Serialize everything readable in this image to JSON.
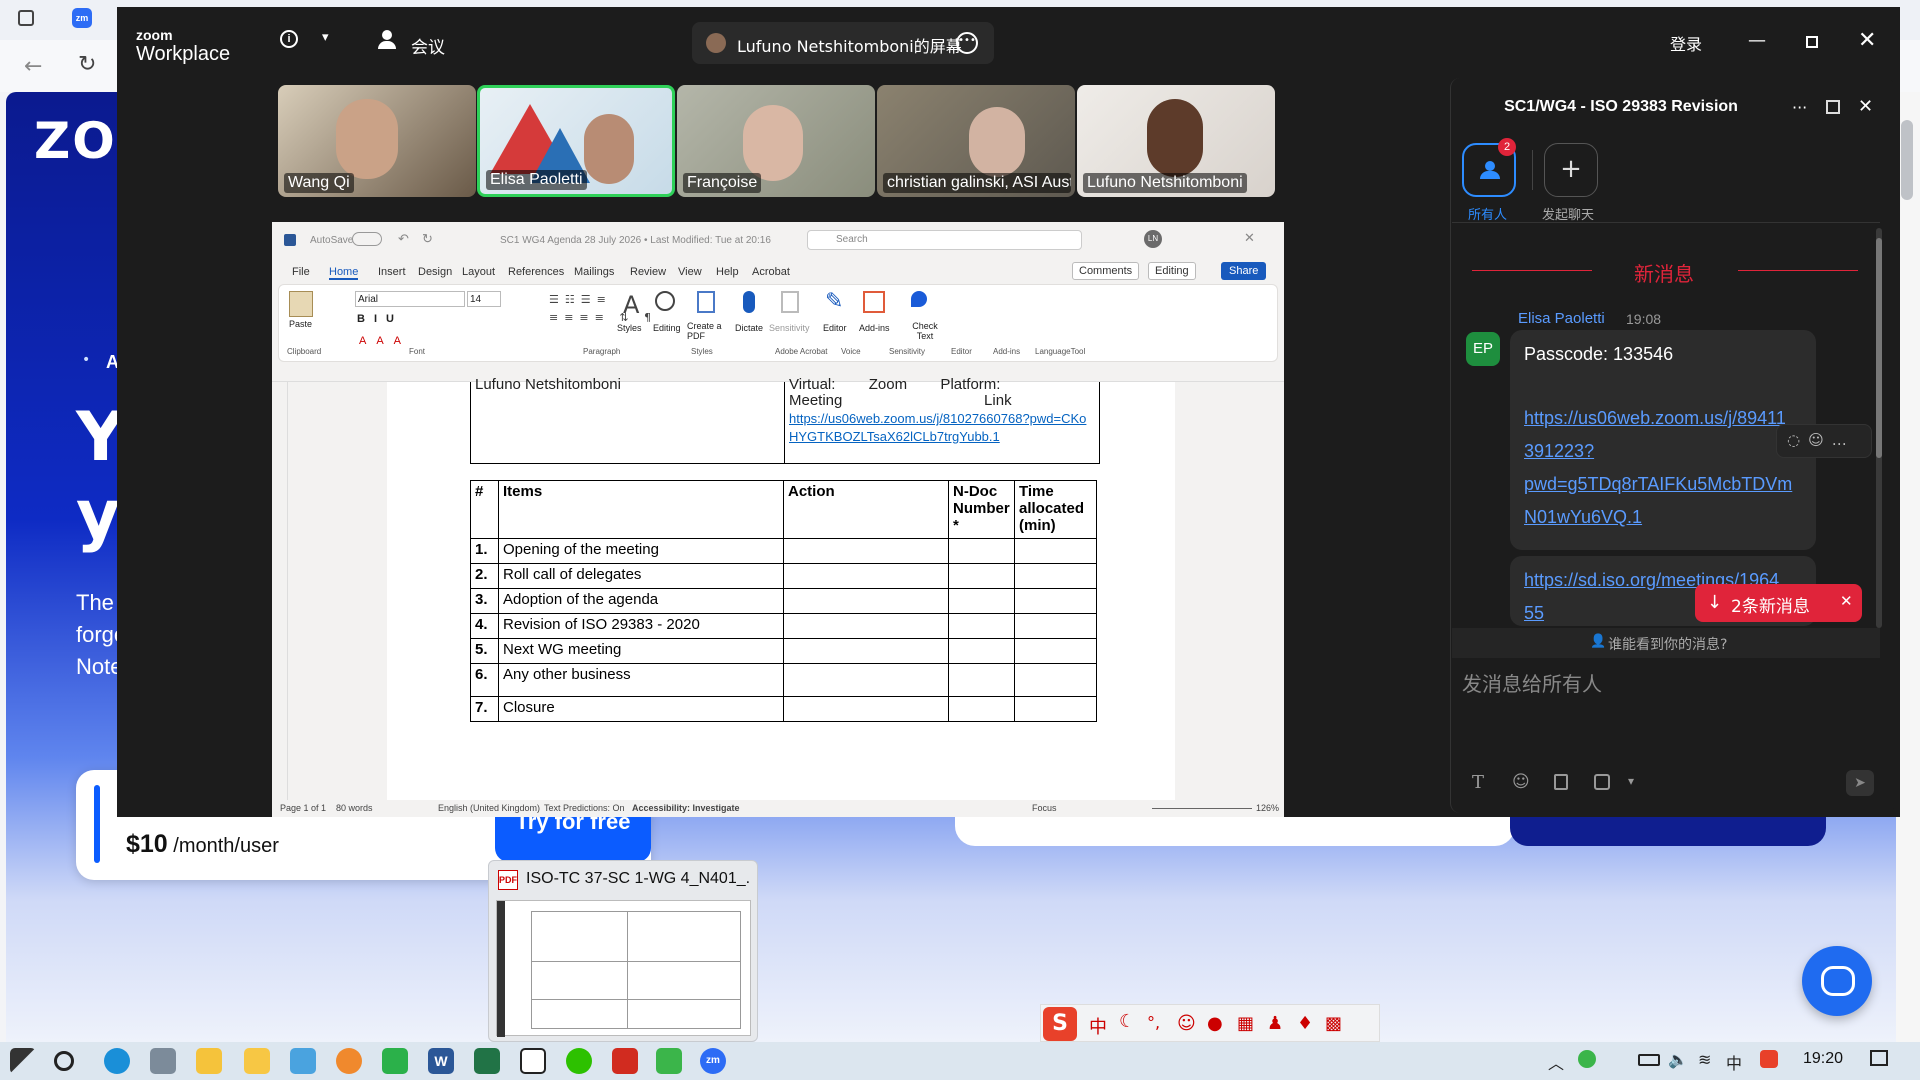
{
  "browser": {
    "site_logo": "ZOO",
    "hero_lines": [
      "Y",
      "y"
    ],
    "hero_bullet": "A",
    "para_lines": [
      "The l",
      "forge",
      "Note"
    ],
    "price_value": "$10",
    "price_unit": "/month/user",
    "try_button": "Try for free"
  },
  "zoom": {
    "brand_small": "zoom",
    "brand_large": "Workplace",
    "meeting_label": "会议",
    "share_label": "Lufuno Netshitomboni的屏幕",
    "login_label": "登录",
    "participants": [
      {
        "name": "Wang Qi",
        "color": "#6a5a48"
      },
      {
        "name": "Elisa Paoletti",
        "color": "#c7dbe8",
        "active": true
      },
      {
        "name": "Françoise",
        "color": "#8a8d7c"
      },
      {
        "name": "christian galinski, ASI Aust...",
        "color": "#5e5950"
      },
      {
        "name": "Lufuno Netshitomboni",
        "color": "#d8d2cc"
      }
    ]
  },
  "word": {
    "titlebar": "SC1 WG4 Agenda 28 July 2026 • Last Modified: Tue at 20:16",
    "autosave": "AutoSave",
    "search_placeholder": "Search",
    "user_initials": "LN",
    "menu": [
      "File",
      "Home",
      "Insert",
      "Design",
      "Layout",
      "References",
      "Mailings",
      "Review",
      "View",
      "Help",
      "Acrobat"
    ],
    "comments_label": "Comments",
    "editing_label": "Editing",
    "share_label": "Share",
    "font_name": "Arial",
    "font_size": "14",
    "ribbon_groups": [
      "Clipboard",
      "Font",
      "Paragraph",
      "Styles",
      "Adobe Acrobat",
      "Voice",
      "Sensitivity",
      "Editor",
      "Add-ins",
      "LanguageTool"
    ],
    "ribbon_buttons": [
      "Paste",
      "Styles",
      "Editing",
      "Create a PDF",
      "Dictate",
      "Sensitivity",
      "Editor",
      "Add-ins",
      "Check Text"
    ],
    "top_box": {
      "left_text": "Lufuno Netshitomboni",
      "right_line1": "Virtual:        Zoom        Platform:",
      "right_line2": "Meeting                                  Link",
      "link": "https://us06web.zoom.us/j/81027660768?pwd=CKoHYGTKBOZLTsaX62lCLb7trgYubb.1"
    },
    "table_headers": [
      "#",
      "Items",
      "Action",
      "N-Doc Number *",
      "Time allocated (min)"
    ],
    "agenda_rows": [
      {
        "num": "1.",
        "item": "Opening of the meeting"
      },
      {
        "num": "2.",
        "item": "Roll call of delegates"
      },
      {
        "num": "3.",
        "item": "Adoption of the agenda"
      },
      {
        "num": "4.",
        "item": "Revision of ISO 29383 - 2020"
      },
      {
        "num": "5.",
        "item": "Next WG meeting"
      },
      {
        "num": "6.",
        "item": "Any other business"
      },
      {
        "num": "7.",
        "item": "Closure"
      }
    ],
    "status": {
      "page": "Page 1 of 1",
      "words": "80 words",
      "language": "English (United Kingdom)",
      "predictions": "Text Predictions: On",
      "accessibility": "Accessibility: Investigate",
      "focus": "Focus",
      "zoom": "126%"
    }
  },
  "chat": {
    "title": "SC1/WG4 - ISO 29383 Revision",
    "everyone_tab": "所有人",
    "everyone_badge": "2",
    "new_chat_tab": "发起聊天",
    "new_messages_divider": "新消息",
    "sender": "Elisa Paoletti",
    "time": "19:08",
    "avatar_initials": "EP",
    "passcode": "Passcode: 133546",
    "link1_lines": [
      "https://us06web.zoom.us/j/89411",
      "391223?",
      "pwd=g5TDq8rTAIFKu5McbTDVm",
      "N01wYu6VQ.1"
    ],
    "link2_lines": [
      "https://sd.iso.org/meetings/1964",
      "55"
    ],
    "new_toast": "2条新消息",
    "who_can_see": "谁能看到你的消息?",
    "compose_placeholder": "发消息给所有人"
  },
  "taskbar": {
    "preview_title": "ISO-TC 37-SC 1-WG 4_N401_...",
    "clock": "19:20"
  }
}
